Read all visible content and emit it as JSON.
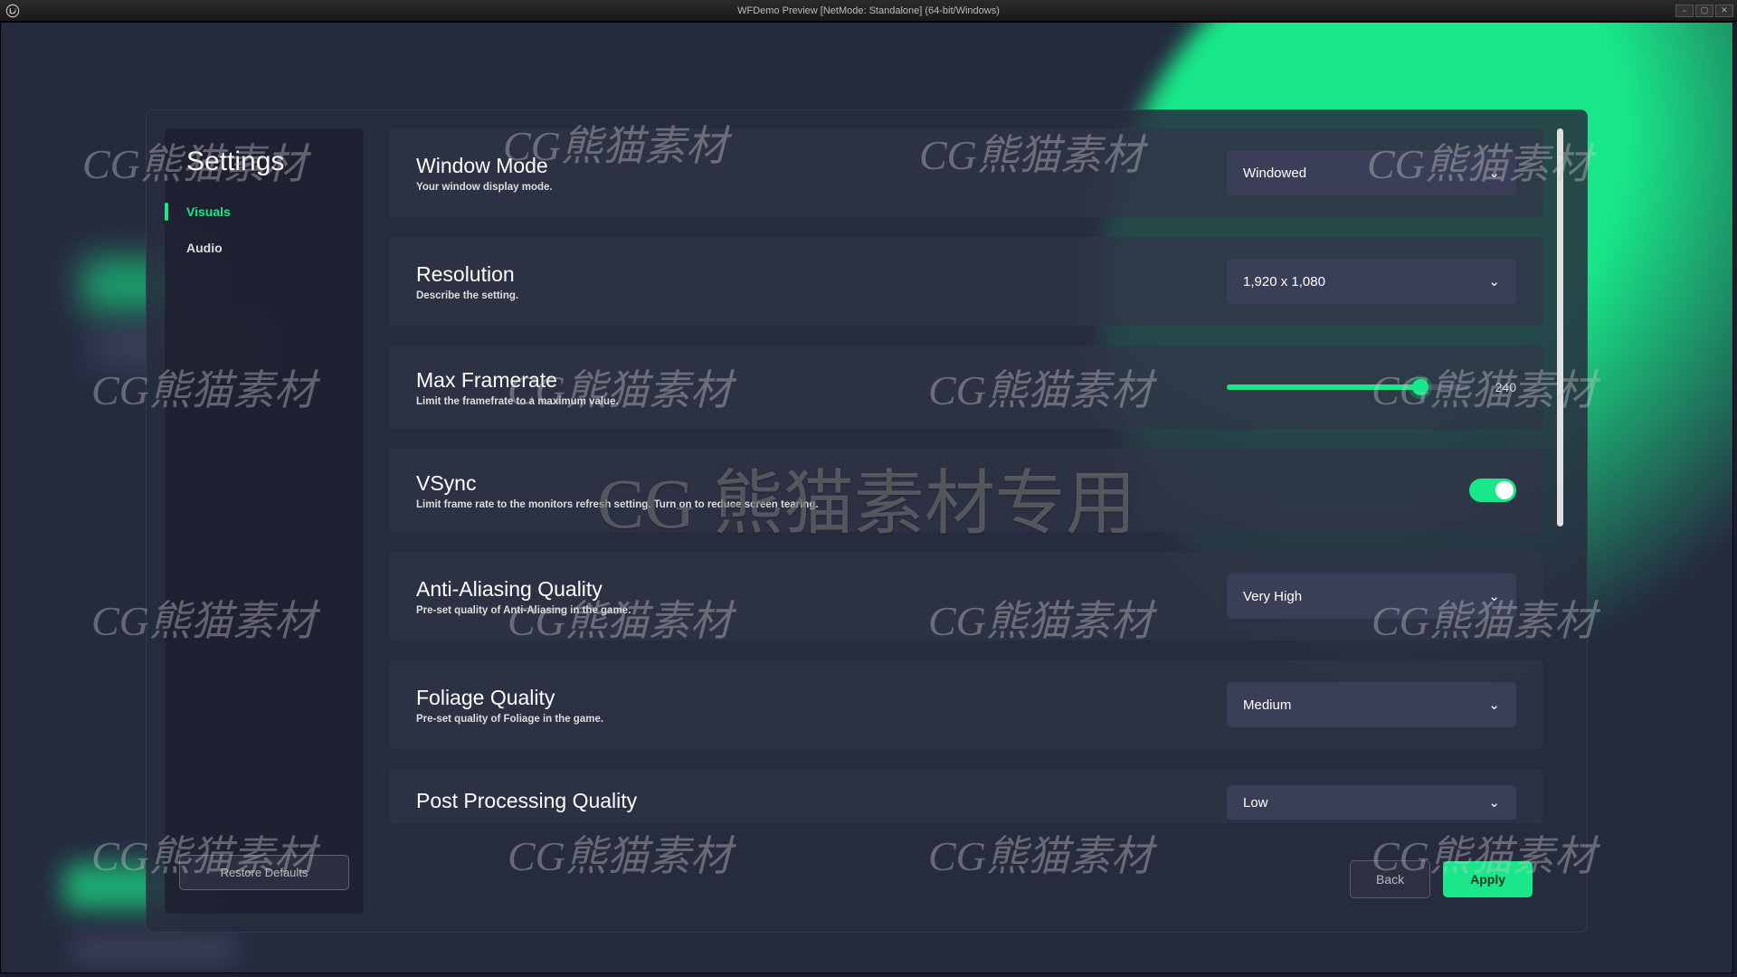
{
  "titlebar": {
    "title": "WFDemo Preview [NetMode: Standalone]  (64-bit/Windows)"
  },
  "panel": {
    "title": "Settings"
  },
  "categories": {
    "c0": "Visuals",
    "c1": "Audio"
  },
  "buttons": {
    "restore": "Restore Defaults",
    "back": "Back",
    "apply": "Apply"
  },
  "rows": {
    "r0": {
      "title": "Window Mode",
      "desc": "Your window display mode.",
      "value": "Windowed"
    },
    "r1": {
      "title": "Resolution",
      "desc": "Describe the setting.",
      "value": "1,920 x 1,080"
    },
    "r2": {
      "title": "Max Framerate",
      "desc": "Limit the framefrate to a maximum value.",
      "value": "240"
    },
    "r3": {
      "title": "VSync",
      "desc": "Limit frame rate to the monitors refresh setting. Turn on to reduce screen tearing."
    },
    "r4": {
      "title": "Anti-Aliasing Quality",
      "desc": "Pre-set quality of Anti-Aliasing in the game.",
      "value": "Very High"
    },
    "r5": {
      "title": "Foliage Quality",
      "desc": "Pre-set quality of Foliage in the game.",
      "value": "Medium"
    },
    "r6": {
      "title": "Post Processing Quality",
      "desc": "",
      "value": "Low"
    }
  },
  "watermark": {
    "small": "CG熊猫素材",
    "big": "CG 熊猫素材专用"
  }
}
